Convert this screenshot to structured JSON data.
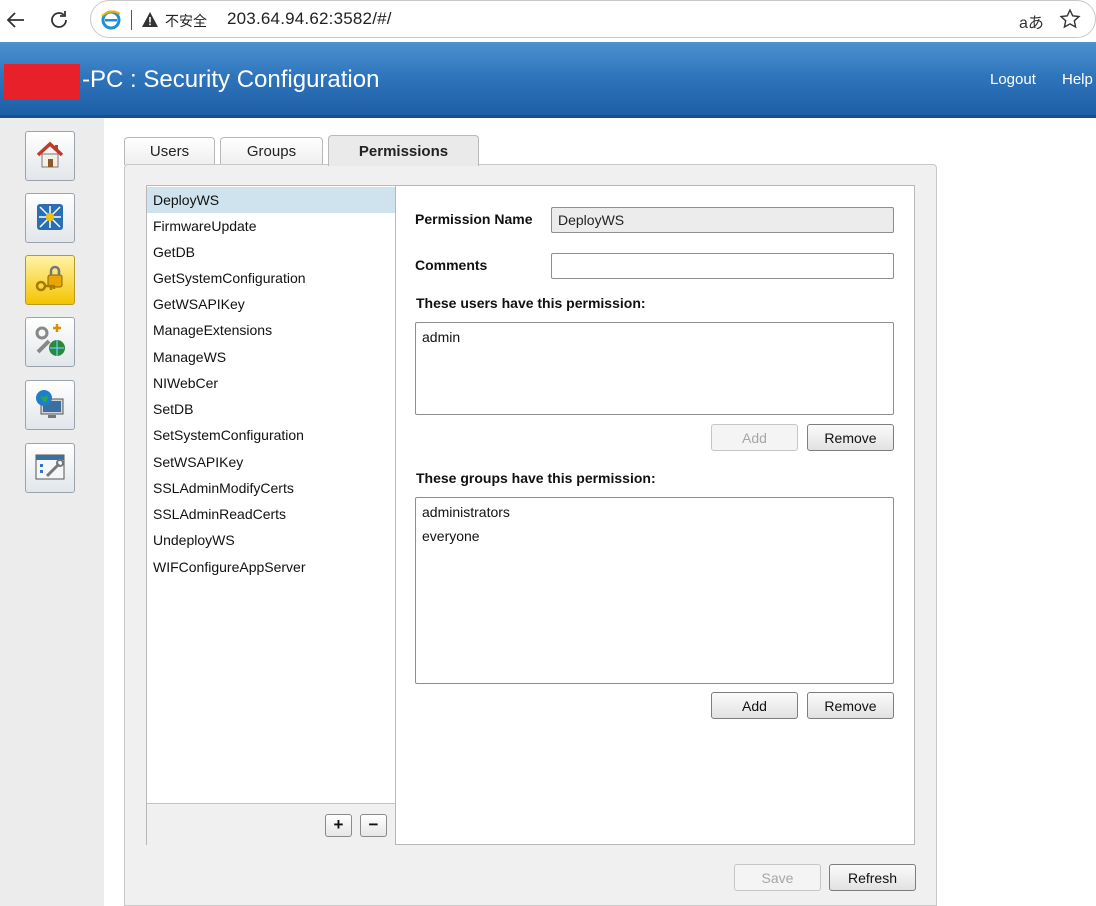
{
  "browser": {
    "insecure_label": "不安全",
    "url": "203.64.94.62:3582/#/",
    "read_aloud_label": "aあ"
  },
  "header": {
    "title": "-PC : Security Configuration",
    "logout_label": "Logout",
    "help_label": "Help"
  },
  "tabs": [
    {
      "label": "Users"
    },
    {
      "label": "Groups"
    },
    {
      "label": "Permissions"
    }
  ],
  "permissions": [
    "DeployWS",
    "FirmwareUpdate",
    "GetDB",
    "GetSystemConfiguration",
    "GetWSAPIKey",
    "ManageExtensions",
    "ManageWS",
    "NIWebCer",
    "SetDB",
    "SetSystemConfiguration",
    "SetWSAPIKey",
    "SSLAdminModifyCerts",
    "SSLAdminReadCerts",
    "UndeployWS",
    "WIFConfigureAppServer"
  ],
  "list_controls": {
    "add_label": "+",
    "remove_label": "−"
  },
  "detail": {
    "permission_name_label": "Permission Name",
    "permission_name_value": "DeployWS",
    "comments_label": "Comments",
    "comments_value": "",
    "users_heading": "These users have this permission:",
    "users": [
      "admin"
    ],
    "groups_heading": "These groups have this permission:",
    "groups": [
      "administrators",
      "everyone"
    ],
    "add_label": "Add",
    "remove_label": "Remove"
  },
  "footer": {
    "save_label": "Save",
    "refresh_label": "Refresh"
  },
  "colors": {
    "header_blue": "#2f76bd",
    "selected_row": "#cfe3ee",
    "active_rail": "#f4c400",
    "redaction": "#e8202a"
  }
}
